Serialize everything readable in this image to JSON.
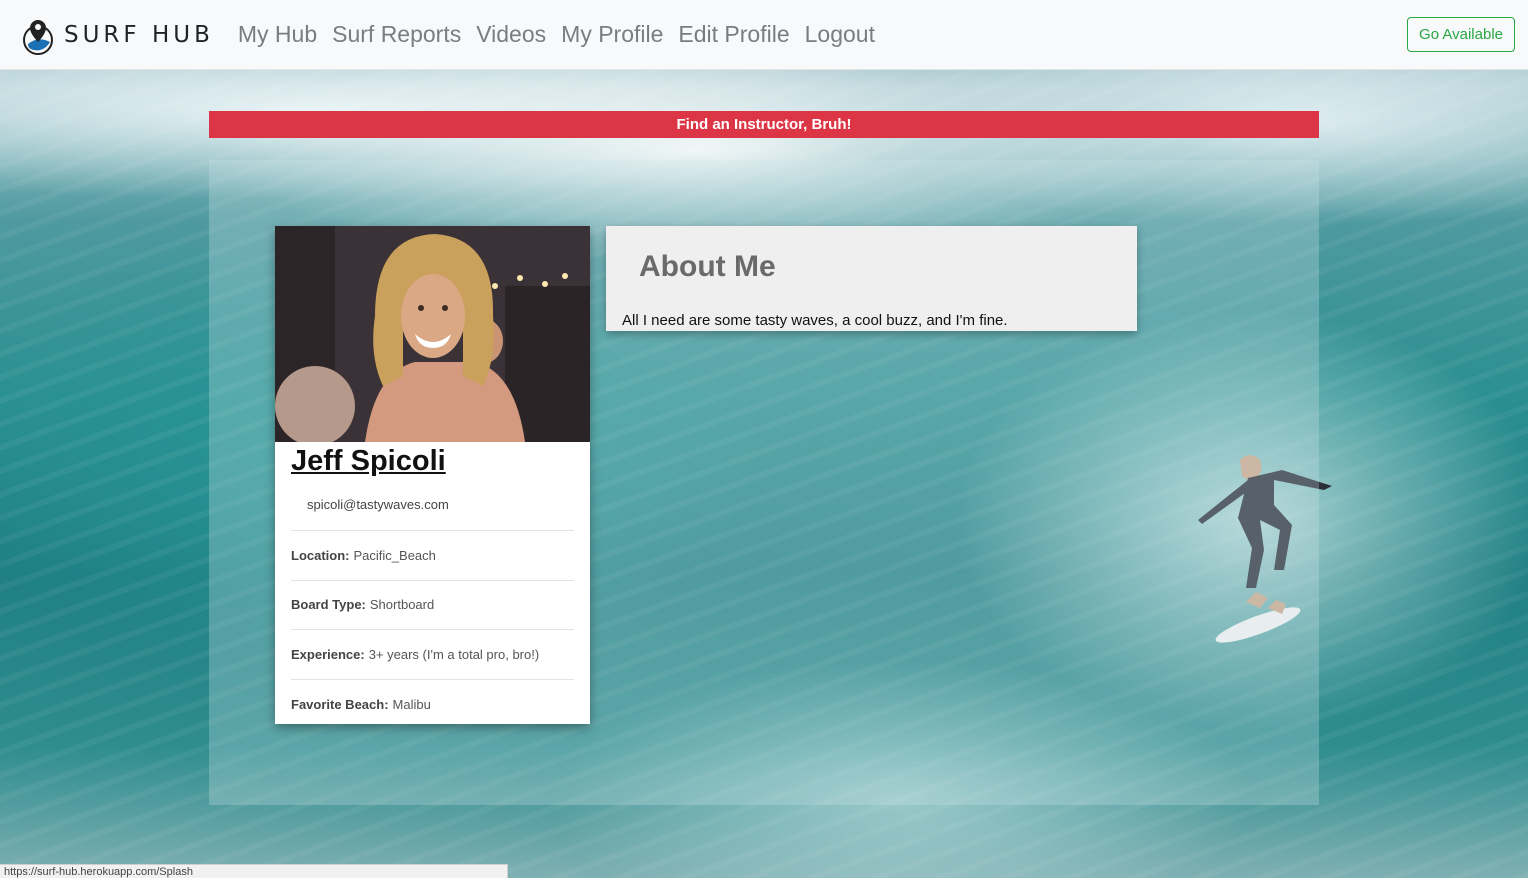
{
  "navbar": {
    "brand": "SURF HUB",
    "links": [
      "My Hub",
      "Surf Reports",
      "Videos",
      "My Profile",
      "Edit Profile",
      "Logout"
    ],
    "status_button": "Go Available"
  },
  "alert": "Find an Instructor, Bruh!",
  "profile": {
    "name": "Jeff Spicoli",
    "email": "spicoli@tastywaves.com",
    "fields": [
      {
        "label": "Location:",
        "value": "Pacific_Beach"
      },
      {
        "label": "Board Type:",
        "value": "Shortboard"
      },
      {
        "label": "Experience:",
        "value": "3+ years (I'm a total pro, bro!)"
      },
      {
        "label": "Favorite Beach:",
        "value": "Malibu"
      }
    ]
  },
  "about": {
    "title": "About Me",
    "text": "All I need are some tasty waves, a cool buzz, and I'm fine."
  },
  "status_url": "https://surf-hub.herokuapp.com/Splash",
  "colors": {
    "alert_bg": "#dc3545",
    "button_green": "#28a745",
    "navbar_bg": "#f8f9fa"
  }
}
